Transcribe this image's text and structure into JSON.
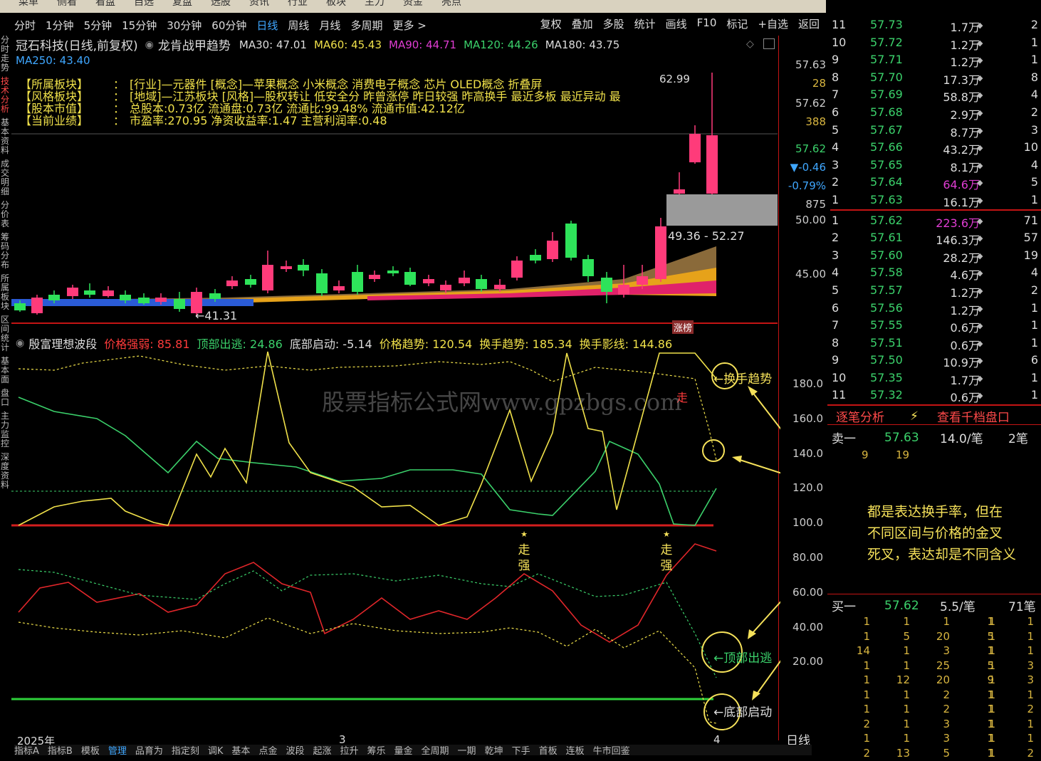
{
  "top_menu": [
    "菜单",
    "侧看",
    "看盘",
    "自选",
    "复盘",
    "选股",
    "资讯",
    "行业",
    "板块",
    "主力",
    "资金",
    "亮点"
  ],
  "toolbar": {
    "periods": [
      "分时",
      "1分钟",
      "5分钟",
      "15分钟",
      "30分钟",
      "60分钟",
      "日线",
      "周线",
      "月线",
      "多周期",
      "更多 >"
    ],
    "active": "日线",
    "right": [
      "复权",
      "叠加",
      "多股",
      "统计",
      "画线",
      "F10",
      "标记",
      "+自选",
      "返回"
    ]
  },
  "left_nav": [
    "分时走势",
    "技术分析",
    "基本资料",
    "成交明细",
    "分价表",
    "筹码分布",
    "所属板块",
    "区间统计",
    "基本面",
    "盘口",
    "主力监控",
    "深度资料"
  ],
  "left_nav_active": "技术分析",
  "title": {
    "stock": "冠石科技(日线,前复权)",
    "indicator": "龙肯战甲趋势",
    "ma": [
      {
        "label": "MA30: 47.01",
        "color": "#dddddd"
      },
      {
        "label": "MA60: 45.43",
        "color": "#f0e14a"
      },
      {
        "label": "MA90: 44.71",
        "color": "#e03dd3"
      },
      {
        "label": "MA120: 44.26",
        "color": "#3bd16b"
      },
      {
        "label": "MA180: 43.75",
        "color": "#dddddd"
      }
    ],
    "ma250": "MA250: 43.40"
  },
  "info": [
    {
      "label": "【所属板块】",
      "value": "[行业]—元器件 [概念]—苹果概念 小米概念 消费电子概念 芯片 OLED概念 折叠屏"
    },
    {
      "label": "【风格板块】",
      "value": "[地域]—江苏板块 [风格]—股权转让 低安全分 昨曾涨停 昨日较强 昨高换手 最近多板 最近异动 最"
    },
    {
      "label": "【股本市值】",
      "value": "总股本:0.73亿 流通盘:0.73亿 流通比:99.48% 流通市值:42.12亿"
    },
    {
      "label": "【当前业绩】",
      "value": "市盈率:270.95 净资收益率:1.47 主营利润率:0.48"
    }
  ],
  "main_chart": {
    "price_axis": [
      "57.63",
      "57.62",
      "57.62",
      "50.00",
      "45.00"
    ],
    "side_vals": {
      "v1": "28",
      "v2": "388",
      "chg": "▼-0.46",
      "pct": "-0.79%",
      "v3": "875"
    },
    "high_label": "62.99",
    "low_label": "←41.31",
    "zone_label": "49.36 - 52.27",
    "limit_tag": "涨榜"
  },
  "indicator": {
    "name": "殷富理想波段",
    "items": [
      {
        "label": "价格强弱: 85.81",
        "color": "#ff3b3b"
      },
      {
        "label": "顶部出逃: 24.86",
        "color": "#3bd16b"
      },
      {
        "label": "底部启动: -5.14",
        "color": "#dddddd"
      },
      {
        "label": "价格趋势: 120.54",
        "color": "#f0e14a"
      },
      {
        "label": "换手趋势: 185.34",
        "color": "#f0e14a"
      },
      {
        "label": "换手影线: 144.86",
        "color": "#f0e14a"
      }
    ],
    "axis": [
      "180.0",
      "160.0",
      "140.0",
      "120.0",
      "100.0",
      "80.00",
      "60.00",
      "40.00",
      "20.00"
    ],
    "callouts": [
      "←换手趋势",
      "←顶部出逃",
      "←底部启动"
    ],
    "strong_label": "走强",
    "walk_label": "走"
  },
  "annotation": [
    "都是表达换手率，但在",
    "不同区间与价格的金叉",
    "死叉，表达却是不同含义"
  ],
  "watermark": "股票指标公式网www.gpzbgs.com",
  "time_axis": {
    "year": "2025年",
    "m3": "3",
    "m4": "4",
    "period": "日线"
  },
  "bottom_tabs": [
    "指标A",
    "指标B",
    "模板",
    "管理",
    "品育为",
    "指定刻",
    "调K",
    "基本",
    "点金",
    "波段",
    "起涨",
    "拉升",
    "筹乐",
    "量金",
    "全周期",
    "一期",
    "乾坤",
    "下手",
    "首板",
    "连板",
    "牛市回鉴"
  ],
  "bottom_active": "管理",
  "asks": [
    {
      "lvl": "11",
      "px": "57.73",
      "vol": "1.7万",
      "n": "2"
    },
    {
      "lvl": "10",
      "px": "57.72",
      "vol": "1.2万",
      "n": "1"
    },
    {
      "lvl": "9",
      "px": "57.71",
      "vol": "1.2万",
      "n": "1"
    },
    {
      "lvl": "8",
      "px": "57.70",
      "vol": "17.3万",
      "n": "8"
    },
    {
      "lvl": "7",
      "px": "57.69",
      "vol": "58.8万",
      "n": "4"
    },
    {
      "lvl": "6",
      "px": "57.68",
      "vol": "2.9万",
      "n": "2"
    },
    {
      "lvl": "5",
      "px": "57.67",
      "vol": "8.7万",
      "n": "3"
    },
    {
      "lvl": "4",
      "px": "57.66",
      "vol": "43.2万",
      "n": "10"
    },
    {
      "lvl": "3",
      "px": "57.65",
      "vol": "8.1万",
      "n": "4"
    },
    {
      "lvl": "2",
      "px": "57.64",
      "vol": "64.6万",
      "n": "5",
      "hi": true
    },
    {
      "lvl": "1",
      "px": "57.63",
      "vol": "16.1万",
      "n": "1"
    }
  ],
  "bids": [
    {
      "lvl": "1",
      "px": "57.62",
      "vol": "223.6万",
      "n": "71",
      "hi": true
    },
    {
      "lvl": "2",
      "px": "57.61",
      "vol": "146.3万",
      "n": "57"
    },
    {
      "lvl": "3",
      "px": "57.60",
      "vol": "28.2万",
      "n": "19"
    },
    {
      "lvl": "4",
      "px": "57.58",
      "vol": "4.6万",
      "n": "4"
    },
    {
      "lvl": "5",
      "px": "57.57",
      "vol": "1.2万",
      "n": "2"
    },
    {
      "lvl": "6",
      "px": "57.56",
      "vol": "1.2万",
      "n": "1"
    },
    {
      "lvl": "7",
      "px": "57.55",
      "vol": "0.6万",
      "n": "1"
    },
    {
      "lvl": "8",
      "px": "57.51",
      "vol": "0.6万",
      "n": "1"
    },
    {
      "lvl": "9",
      "px": "57.50",
      "vol": "10.9万",
      "n": "6"
    },
    {
      "lvl": "10",
      "px": "57.35",
      "vol": "1.7万",
      "n": "1"
    },
    {
      "lvl": "11",
      "px": "57.32",
      "vol": "0.6万",
      "n": "1"
    }
  ],
  "ticks_tabs": {
    "a": "逐笔分析",
    "b": "查看千档盘口"
  },
  "sell1": {
    "label": "卖一",
    "px": "57.63",
    "per": "14.0/笔",
    "n": "2笔",
    "sub1": "9",
    "sub2": "19"
  },
  "buy1": {
    "label": "买一",
    "px": "57.62",
    "per": "5.5/笔",
    "n": "71笔"
  },
  "buy_queue": [
    [
      "1",
      "1",
      "1",
      "1",
      "1",
      "1"
    ],
    [
      "1",
      "5",
      "20",
      "5",
      "1",
      "1"
    ],
    [
      "14",
      "1",
      "3",
      "1",
      "1",
      "1"
    ],
    [
      "1",
      "1",
      "25",
      "5",
      "1",
      "3"
    ],
    [
      "1",
      "12",
      "20",
      "9",
      "1",
      "3"
    ],
    [
      "1",
      "1",
      "2",
      "1",
      "1",
      "1"
    ],
    [
      "1",
      "1",
      "2",
      "1",
      "1",
      "2"
    ],
    [
      "2",
      "1",
      "3",
      "1",
      "1",
      "1"
    ],
    [
      "1",
      "1",
      "3",
      "1",
      "1",
      "1"
    ],
    [
      "2",
      "13",
      "5",
      "1",
      "1",
      "2"
    ]
  ],
  "colors": {
    "up": "#ff3b7a",
    "down": "#2ee35a",
    "red_axis": "#c41414",
    "accent": "#3fa7ff"
  }
}
